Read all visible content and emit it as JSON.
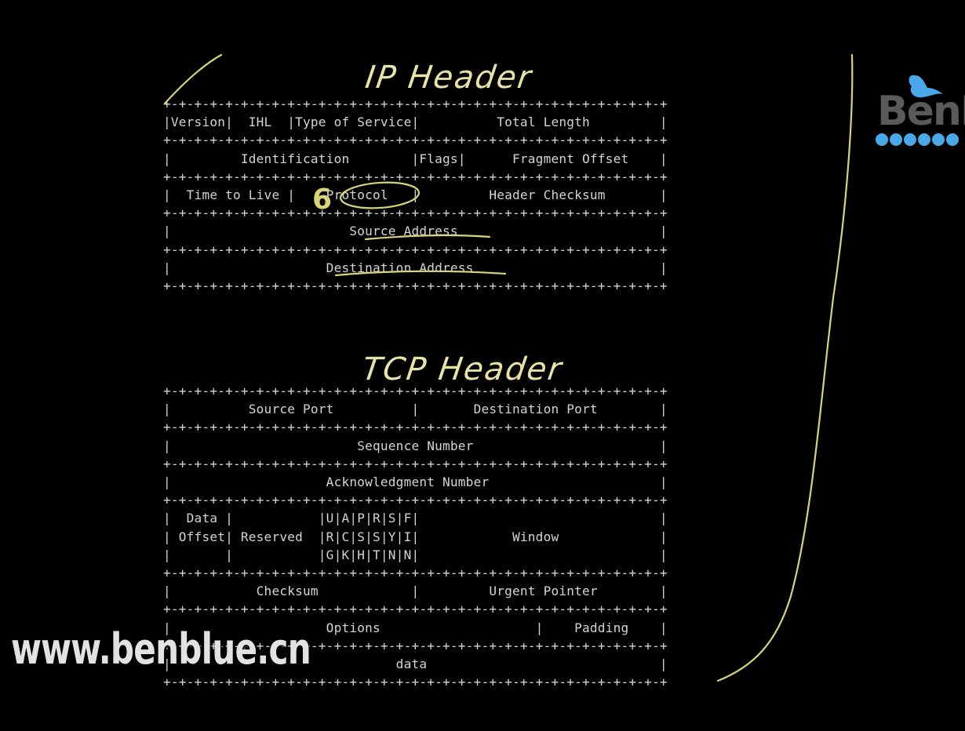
{
  "ip_header": {
    "title": "IP Header",
    "lines": [
      "+-+-+-+-+-+-+-+-+-+-+-+-+-+-+-+-+-+-+-+-+-+-+-+-+-+-+-+-+-+-+-+-+",
      "|Version|  IHL  |Type of Service|          Total Length         |",
      "+-+-+-+-+-+-+-+-+-+-+-+-+-+-+-+-+-+-+-+-+-+-+-+-+-+-+-+-+-+-+-+-+",
      "|         Identification        |Flags|      Fragment Offset    |",
      "+-+-+-+-+-+-+-+-+-+-+-+-+-+-+-+-+-+-+-+-+-+-+-+-+-+-+-+-+-+-+-+-+",
      "|  Time to Live |    Protocol   |         Header Checksum       |",
      "+-+-+-+-+-+-+-+-+-+-+-+-+-+-+-+-+-+-+-+-+-+-+-+-+-+-+-+-+-+-+-+-+",
      "|                       Source Address                          |",
      "+-+-+-+-+-+-+-+-+-+-+-+-+-+-+-+-+-+-+-+-+-+-+-+-+-+-+-+-+-+-+-+-+",
      "|                    Destination Address                        |",
      "+-+-+-+-+-+-+-+-+-+-+-+-+-+-+-+-+-+-+-+-+-+-+-+-+-+-+-+-+-+-+-+-+"
    ]
  },
  "tcp_header": {
    "title": "TCP Header",
    "lines": [
      "+-+-+-+-+-+-+-+-+-+-+-+-+-+-+-+-+-+-+-+-+-+-+-+-+-+-+-+-+-+-+-+-+",
      "|          Source Port          |       Destination Port        |",
      "+-+-+-+-+-+-+-+-+-+-+-+-+-+-+-+-+-+-+-+-+-+-+-+-+-+-+-+-+-+-+-+-+",
      "|                        Sequence Number                        |",
      "+-+-+-+-+-+-+-+-+-+-+-+-+-+-+-+-+-+-+-+-+-+-+-+-+-+-+-+-+-+-+-+-+",
      "|                    Acknowledgment Number                      |",
      "+-+-+-+-+-+-+-+-+-+-+-+-+-+-+-+-+-+-+-+-+-+-+-+-+-+-+-+-+-+-+-+-+",
      "|  Data |           |U|A|P|R|S|F|                               |",
      "| Offset| Reserved  |R|C|S|S|Y|I|            Window             |",
      "|       |           |G|K|H|T|N|N|                               |",
      "+-+-+-+-+-+-+-+-+-+-+-+-+-+-+-+-+-+-+-+-+-+-+-+-+-+-+-+-+-+-+-+-+",
      "|           Checksum            |         Urgent Pointer        |",
      "+-+-+-+-+-+-+-+-+-+-+-+-+-+-+-+-+-+-+-+-+-+-+-+-+-+-+-+-+-+-+-+-+",
      "|                    Options                    |    Padding    |",
      "+-+-+-+-+-+-+-+-+-+-+-+-+-+-+-+-+-+-+-+-+-+-+-+-+-+-+-+-+-+-+-+-+",
      "|                             data                              |",
      "+-+-+-+-+-+-+-+-+-+-+-+-+-+-+-+-+-+-+-+-+-+-+-+-+-+-+-+-+-+-+-+-+"
    ]
  },
  "annotations": {
    "protocol_value": "6"
  },
  "watermark": {
    "url": "www.benblue.cn",
    "logo_text": "BenB"
  },
  "colors": {
    "background": "#000000",
    "text": "#d4d4d4",
    "ink": "#d8d47a",
    "ink_title": "#e8e4a8",
    "logo_blue": "#4aa8e8",
    "logo_ghost": "#5a5a5a"
  }
}
